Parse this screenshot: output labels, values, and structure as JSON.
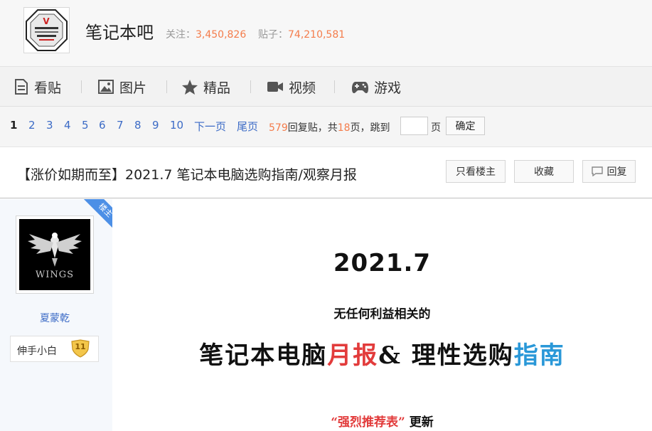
{
  "forum": {
    "name": "笔记本吧",
    "follow_label": "关注：",
    "follow_count": "3,450,826",
    "posts_label": "贴子：",
    "posts_count": "74,210,581",
    "logo_icon": "forum-logo-icon"
  },
  "tabs": [
    {
      "label": "看贴",
      "icon": "document-icon"
    },
    {
      "label": "图片",
      "icon": "image-icon"
    },
    {
      "label": "精品",
      "icon": "star-icon"
    },
    {
      "label": "视频",
      "icon": "video-icon"
    },
    {
      "label": "游戏",
      "icon": "gamepad-icon"
    }
  ],
  "pager": {
    "current": "1",
    "pages": [
      "2",
      "3",
      "4",
      "5",
      "6",
      "7",
      "8",
      "9",
      "10"
    ],
    "next": "下一页",
    "last": "尾页",
    "reply_count": "579",
    "reply_label": "回复贴，共",
    "page_total": "18",
    "page_total_suffix": "页，跳到",
    "page_unit": "页",
    "confirm": "确定"
  },
  "thread": {
    "title": "【涨价如期而至】2021.7 笔记本电脑选购指南/观察月报",
    "only_op": "只看楼主",
    "favorite": "收藏",
    "reply": "回复"
  },
  "author": {
    "ribbon": "楼主",
    "avatar_text": "WINGS",
    "name": "夏蒙乾",
    "badge": "伸手小白",
    "level": "11"
  },
  "content": {
    "year": "2021.7",
    "subtitle": "无任何利益相关的",
    "headline_a": "笔记本电脑",
    "headline_b": "月报",
    "headline_c": "& 理性选购",
    "headline_d": "指南",
    "note_a": "“强烈推荐表”",
    "note_b": " 更新"
  },
  "colors": {
    "accent_orange": "#f47c4b",
    "link_blue": "#3c6bc6",
    "ribbon_blue": "#4c8fe6",
    "headline_red": "#e23b3b",
    "headline_blue": "#2a98d8"
  }
}
